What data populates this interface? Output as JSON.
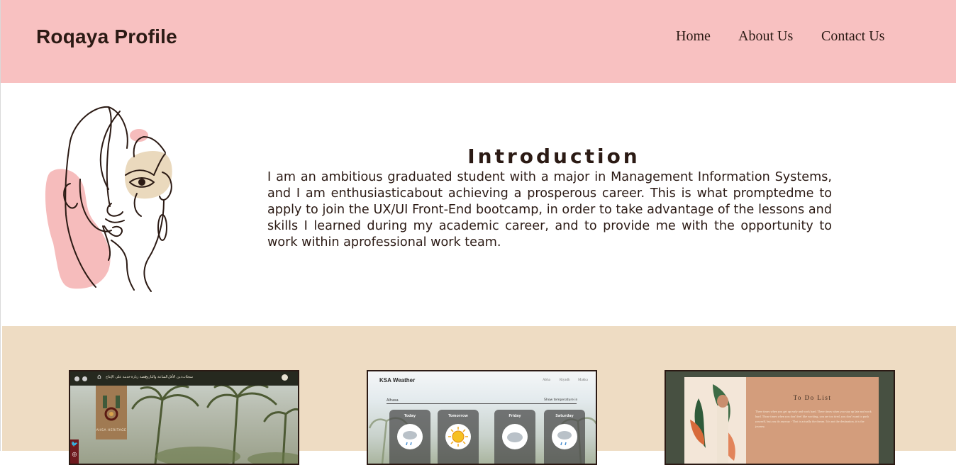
{
  "header": {
    "brand": "Roqaya Profile",
    "nav": [
      "Home",
      "About Us",
      "Contact Us"
    ]
  },
  "intro": {
    "title": "Introduction",
    "text": "I am an ambitious graduated student with a major in Management Information Systems, and I am enthusiasticabout achieving a prosperous career. This is what promptedme to apply to join the UX/UI Front-End bootcamp, in order to take advantage of the lessons and skills I learned during my academic career, and to provide me with the opportunity to work within aprofessional work team."
  },
  "projects": {
    "cards": [
      {
        "nav_items": [
          "سجلات",
          "دين الأقل",
          "الساعة والتاريخ",
          "قصة زيارة",
          "خدمة على الإنتاج"
        ],
        "emblem_text": "AHSA HERITAGE"
      },
      {
        "title": "KSA Weather",
        "nav_items": [
          "Abha",
          "Riyadh",
          "Makka"
        ],
        "select_value": "Alhasa",
        "select_right": "Show temperature in",
        "days": [
          "Today",
          "Tomorrow",
          "Friday",
          "Saturday"
        ]
      },
      {
        "title": "To Do List",
        "text": "There times when you get up early and work hard. There times when you stay up late and work hard. Those times when you don't feel like working, you are too tired, you don't want to push yourself, but you do anyway - That is actually the dream. It is not the destination, it is the journey."
      }
    ]
  },
  "colors": {
    "header_bg": "#f8c1c1",
    "projects_bg": "#eedcc3",
    "text": "#2b1a14"
  },
  "icons": {
    "portrait": "line-art-face-illustration",
    "weather_icons": [
      "rain-cloud-icon",
      "sun-icon",
      "cloud-icon",
      "rain-cloud-icon"
    ]
  }
}
